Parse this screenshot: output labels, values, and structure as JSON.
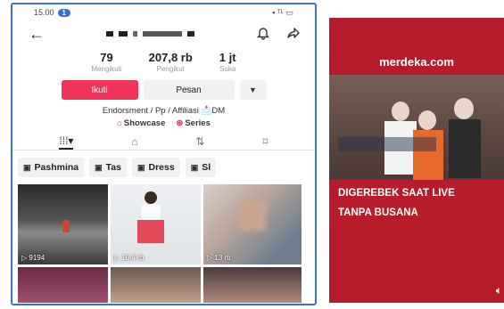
{
  "status": {
    "time": "15.00",
    "notif_count": "1",
    "right": "▪ ᵀᴸ ▭"
  },
  "topbar": {
    "back_icon": "back-arrow-icon",
    "bell_icon": "bell-icon",
    "share_icon": "share-icon"
  },
  "stats": [
    {
      "value": "79",
      "label": "Mengikuti"
    },
    {
      "value": "207,8 rb",
      "label": "Pengikut"
    },
    {
      "value": "1 jt",
      "label": "Suka"
    }
  ],
  "actions": {
    "follow": "Ikuti",
    "message": "Pesan",
    "more": "▼"
  },
  "bio": "Endorsment / Pp / Affiliasi 📩DM",
  "links": [
    {
      "icon": "showcase-icon",
      "label": "Showcase"
    },
    {
      "icon": "series-icon",
      "label": "Series"
    }
  ],
  "tabs": [
    "⁞⁞⁞▾",
    "⌂",
    "⇅",
    "⌑"
  ],
  "chips": [
    "Pashmina",
    "Tas",
    "Dress",
    "Sl"
  ],
  "videos": [
    {
      "views": "9194"
    },
    {
      "views": "10,4 rb"
    },
    {
      "views": "13 rb"
    }
  ],
  "news": {
    "logo": "merdeka.com",
    "line1": "DIGEREBEK SAAT LIVE",
    "line2": "TANPA BUSANA",
    "volume_icon": "speaker-icon"
  }
}
